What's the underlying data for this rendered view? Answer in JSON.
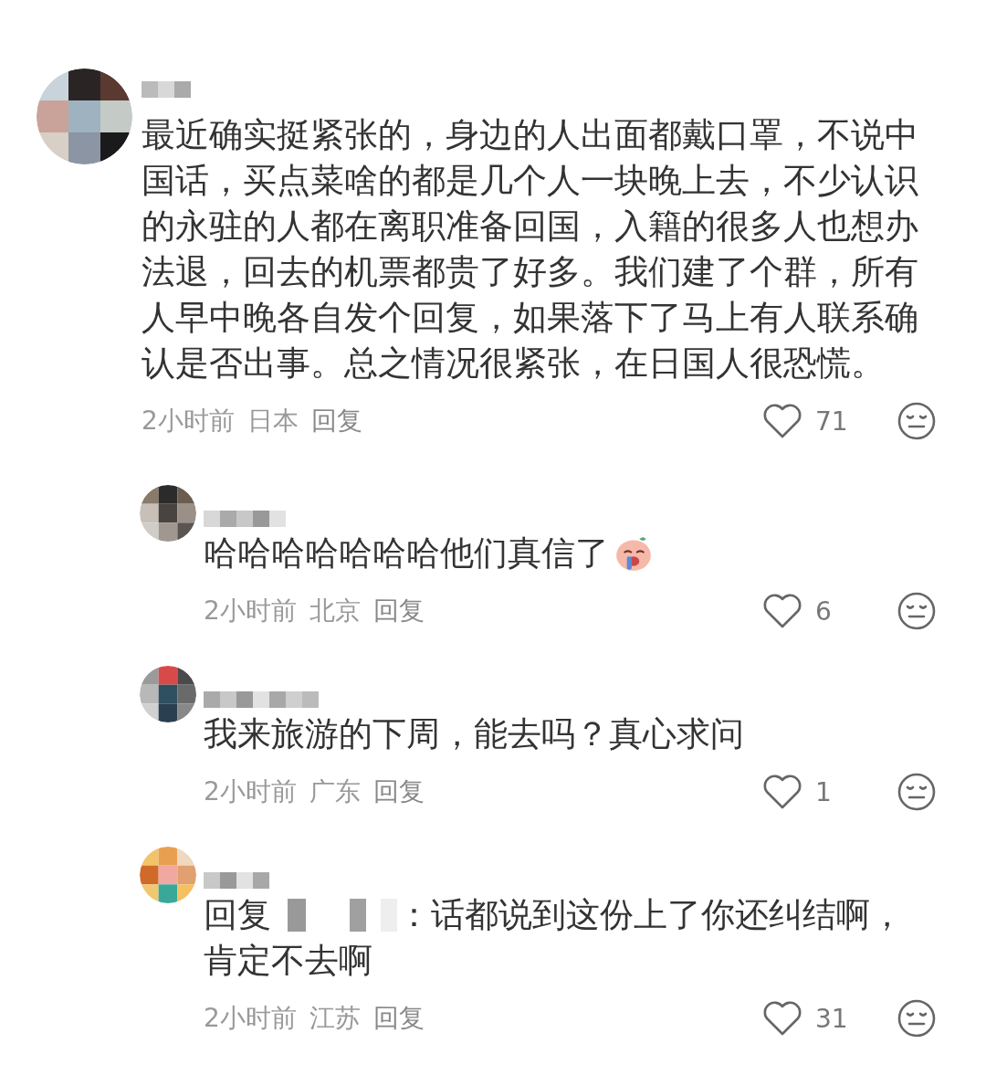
{
  "comments": [
    {
      "kind": "top",
      "text": "最近确实挺紧张的，身边的人出面都戴口罩，不说中国话，买点菜啥的都是几个人一块晚上去，不少认识的永驻的人都在离职准备回国，入籍的很多人也想办法退，回去的机票都贵了好多。我们建了个群，所有人早中晚各自发个回复，如果落下了马上有人联系确认是否出事。总之情况很紧张，在日国人很恐慌。",
      "time": "2小时前",
      "location": "日本",
      "reply_label": "回复",
      "likes": "71"
    },
    {
      "kind": "reply",
      "text": "哈哈哈哈哈哈哈他们真信了",
      "emoji": true,
      "time": "2小时前",
      "location": "北京",
      "reply_label": "回复",
      "likes": "6"
    },
    {
      "kind": "reply",
      "text": "我来旅游的下周，能去吗？真心求问",
      "time": "2小时前",
      "location": "广东",
      "reply_label": "回复",
      "likes": "1"
    },
    {
      "kind": "reply",
      "reply_prefix": "回复",
      "text_lines": [
        "：话都说到这份上了你还纠结啊，",
        "肯定不去啊"
      ],
      "time": "2小时前",
      "location": "江苏",
      "reply_label": "回复",
      "likes": "31"
    }
  ]
}
